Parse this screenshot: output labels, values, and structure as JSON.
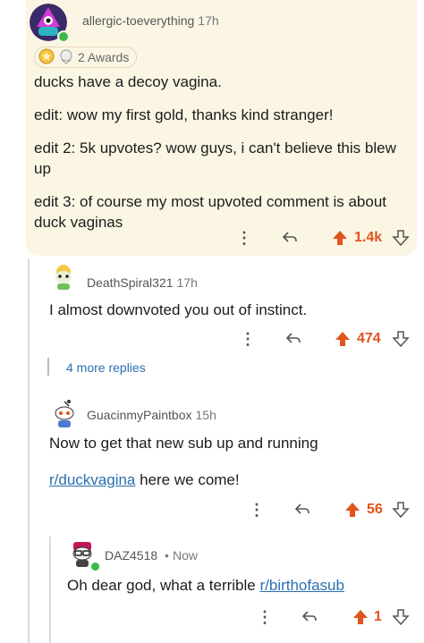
{
  "colors": {
    "accent": "#e2531d",
    "link": "#2a6fb0",
    "highlight": "#fbf6e4"
  },
  "comment1": {
    "username": "allergic-toeverything",
    "time": "17h",
    "awards_label": "2 Awards",
    "lines": [
      "ducks have a decoy vagina.",
      "edit: wow my first gold, thanks kind stranger!",
      "edit 2: 5k upvotes? wow guys, i can't believe this blew up",
      "edit 3: of course my most upvoted comment is about duck vaginas"
    ],
    "score": "1.4k"
  },
  "comment2": {
    "username": "DeathSpiral321",
    "time": "17h",
    "text": "I almost downvoted you out of instinct.",
    "score": "474",
    "more_replies": "4 more replies"
  },
  "comment3": {
    "username": "GuacinmyPaintbox",
    "time": "15h",
    "text": "Now to get that new sub up and running",
    "link": "r/duckvagina",
    "link_suffix": " here we come!",
    "score": "56"
  },
  "comment4": {
    "username": "DAZ4518",
    "time": "Now",
    "text_prefix": "Oh dear god, what a terrible ",
    "link": "r/birthofasub",
    "score": "1"
  }
}
